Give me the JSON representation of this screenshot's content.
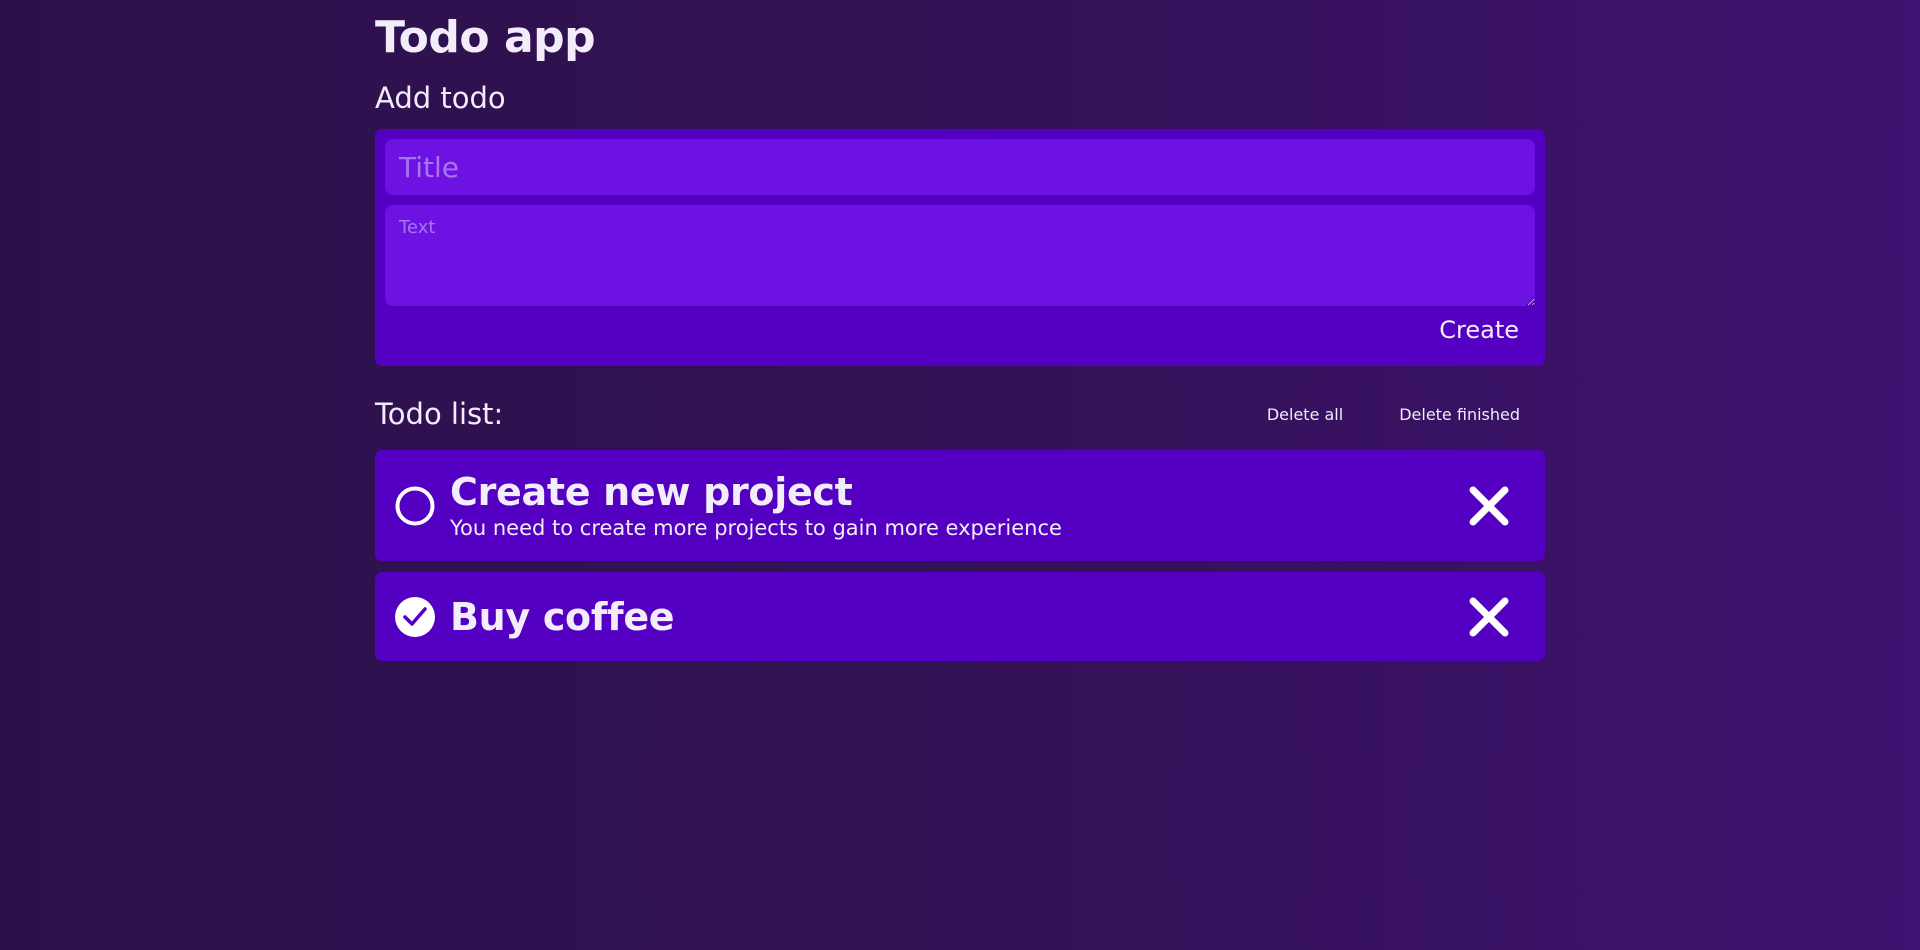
{
  "app": {
    "title": "Todo app"
  },
  "add_form": {
    "heading": "Add todo",
    "title_placeholder": "Title",
    "title_value": "",
    "text_placeholder": "Text",
    "text_value": "",
    "create_label": "Create"
  },
  "todo_list": {
    "heading": "Todo list:",
    "delete_all_label": "Delete all",
    "delete_finished_label": "Delete finished",
    "items": [
      {
        "title": "Create new project",
        "text": "You need to create more projects to gain more experience",
        "done": false,
        "status_icon": "circle-icon",
        "delete_icon": "close-icon"
      },
      {
        "title": "Buy coffee",
        "text": "",
        "done": true,
        "status_icon": "check-circle-icon",
        "delete_icon": "close-icon"
      }
    ]
  },
  "colors": {
    "background": "#2b1149",
    "card": "#5400c2",
    "input": "#6d12e2",
    "placeholder": "#a677ec",
    "text": "#f2ecfb"
  }
}
